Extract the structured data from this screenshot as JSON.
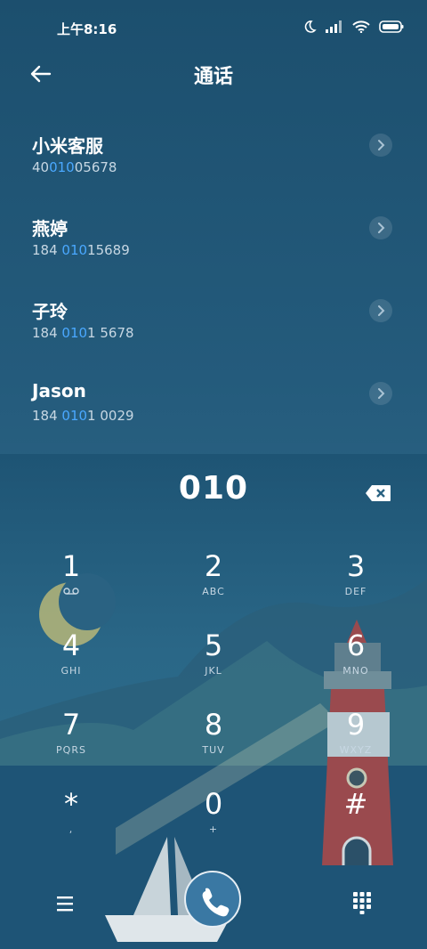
{
  "status": {
    "time": "上午8:16"
  },
  "header": {
    "title": "通话"
  },
  "results": [
    {
      "name": "小米客服",
      "num_pre": "40",
      "num_hl": "010",
      "num_post": "05678"
    },
    {
      "name": "燕婷",
      "num_pre": "184 ",
      "num_hl": "010",
      "num_post": "15689"
    },
    {
      "name": "子玲",
      "num_pre": "184 ",
      "num_hl": "010",
      "num_post": "1 5678"
    },
    {
      "name": "Jason",
      "num_pre": "184 ",
      "num_hl": "010",
      "num_post": "1 0029"
    }
  ],
  "dialer": {
    "entered": "010",
    "keys": [
      {
        "digit": "1",
        "letters": ""
      },
      {
        "digit": "2",
        "letters": "ABC"
      },
      {
        "digit": "3",
        "letters": "DEF"
      },
      {
        "digit": "4",
        "letters": "GHI"
      },
      {
        "digit": "5",
        "letters": "JKL"
      },
      {
        "digit": "6",
        "letters": "MNO"
      },
      {
        "digit": "7",
        "letters": "PQRS"
      },
      {
        "digit": "8",
        "letters": "TUV"
      },
      {
        "digit": "9",
        "letters": "WXYZ"
      },
      {
        "digit": "*",
        "letters": ","
      },
      {
        "digit": "0",
        "letters": "+"
      },
      {
        "digit": "#",
        "letters": ""
      }
    ]
  },
  "colors": {
    "highlight": "#4aa8ff",
    "call_button": "#3a78a3"
  }
}
